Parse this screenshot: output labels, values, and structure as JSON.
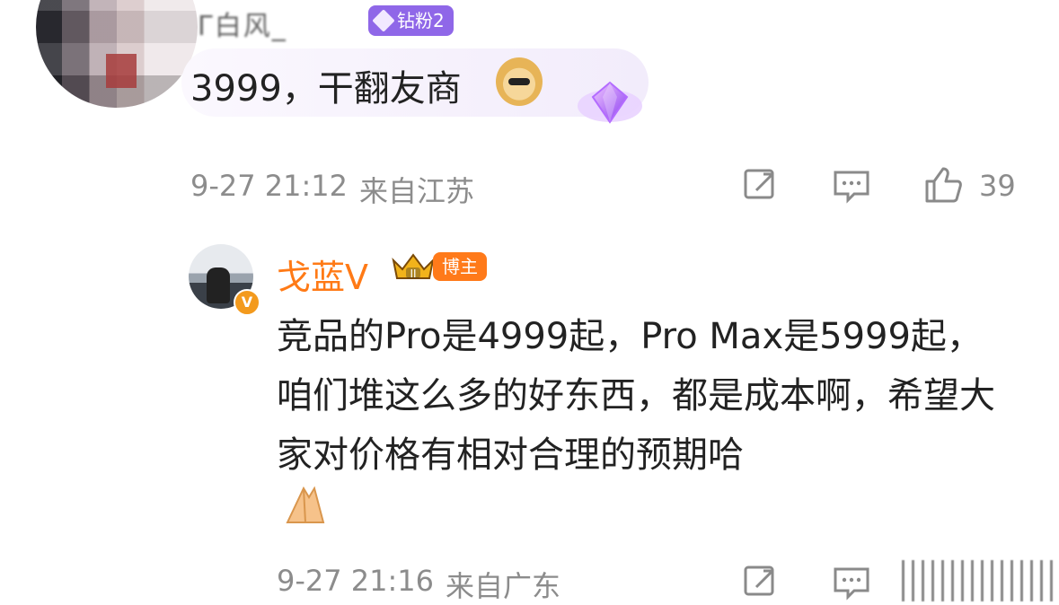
{
  "first_comment": {
    "username": "Γ​白风_",
    "fan_badge": "钻粉2",
    "text": "3999，干翻友商",
    "timestamp": "9-27 21:12",
    "location": "来自江苏",
    "like_count": "39",
    "emoji_name": "doge",
    "gem_name": "purple-diamond"
  },
  "reply": {
    "username": "戈蓝V",
    "badge": "博主",
    "text": "竞品的Pro是4999起，Pro Max是5999起，咱们堆这么多的好东西，都是成本啊，希望大家对价格有相对合理的预期哈",
    "timestamp": "9-27 21:16",
    "location": "来自广东",
    "emoji_name": "pray-hands"
  },
  "colors": {
    "orange_accent": "#ff7a16",
    "purple_badge": "#8f67e8",
    "meta_gray": "#8c8c8c"
  },
  "icons": {
    "share": "share-icon",
    "comment": "comment-icon",
    "like": "thumbs-up-icon"
  }
}
